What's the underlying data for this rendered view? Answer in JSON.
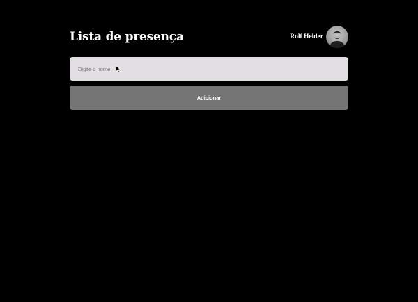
{
  "header": {
    "title": "Lista de presença",
    "user_name": "Rolf Helder"
  },
  "form": {
    "input_placeholder": "Digite o nome",
    "input_value": "",
    "add_button_label": "Adicionar"
  },
  "icons": {
    "avatar": "user-photo-avatar",
    "cursor": "mouse-pointer-icon"
  },
  "colors": {
    "background": "#000000",
    "input_background": "#e2dfe2",
    "button_background": "#767576",
    "text": "#ffffff"
  }
}
